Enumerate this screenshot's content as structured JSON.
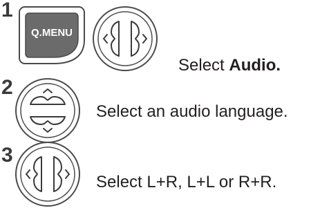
{
  "steps": [
    {
      "number": "1",
      "text_prefix": "Select ",
      "text_bold": "Audio.",
      "keys": [
        "q-menu-button",
        "left-right-navigation-key"
      ],
      "key_label": "Q.MENU"
    },
    {
      "number": "2",
      "text": "Select an audio language.",
      "keys": [
        "up-down-navigation-key"
      ]
    },
    {
      "number": "3",
      "text": "Select L+R, L+L or R+R.",
      "keys": [
        "left-right-navigation-key"
      ]
    }
  ]
}
